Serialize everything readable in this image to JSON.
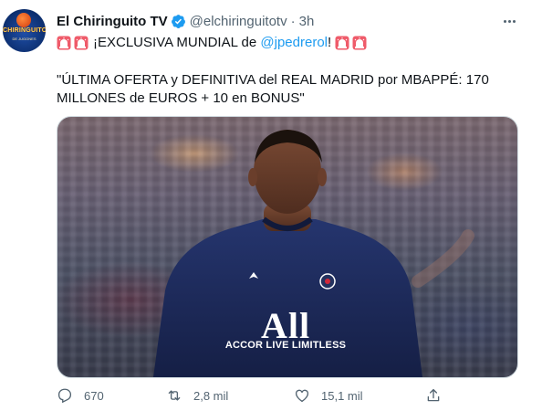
{
  "author": {
    "display_name": "El Chiringuito TV",
    "handle": "@elchiringuitotv",
    "separator": "·",
    "time": "3h",
    "verified": true,
    "avatar_text": "CHIRINGUITO",
    "avatar_subtext": "DE JUGONES"
  },
  "tweet": {
    "exclusive_text": "¡EXCLUSIVA MUNDIAL de ",
    "mention": "@jpedrerol",
    "after_mention": "!",
    "quote_line1": "\"ÚLTIMA OFERTA y DEFINITIVA del REAL MADRID por MBAPPÉ: 170",
    "quote_line2": "MILLONES de EUROS + 10 en BONUS\""
  },
  "media": {
    "jersey_text": "All",
    "jersey_sponsor": "ACCOR LIVE LIMITLESS"
  },
  "actions": {
    "reply_count": "670",
    "retweet_count": "2,8 mil",
    "like_count": "15,1 mil"
  },
  "icons": {
    "siren": "siren-icon",
    "verified": "verified-badge-icon",
    "more": "more-icon",
    "reply": "reply-icon",
    "retweet": "retweet-icon",
    "like": "like-icon",
    "share": "share-icon"
  },
  "colors": {
    "link": "#1d9bf0",
    "text": "#0f1419",
    "secondary": "#536471",
    "siren": "#e8364a",
    "jersey": "#1c2a5c"
  }
}
